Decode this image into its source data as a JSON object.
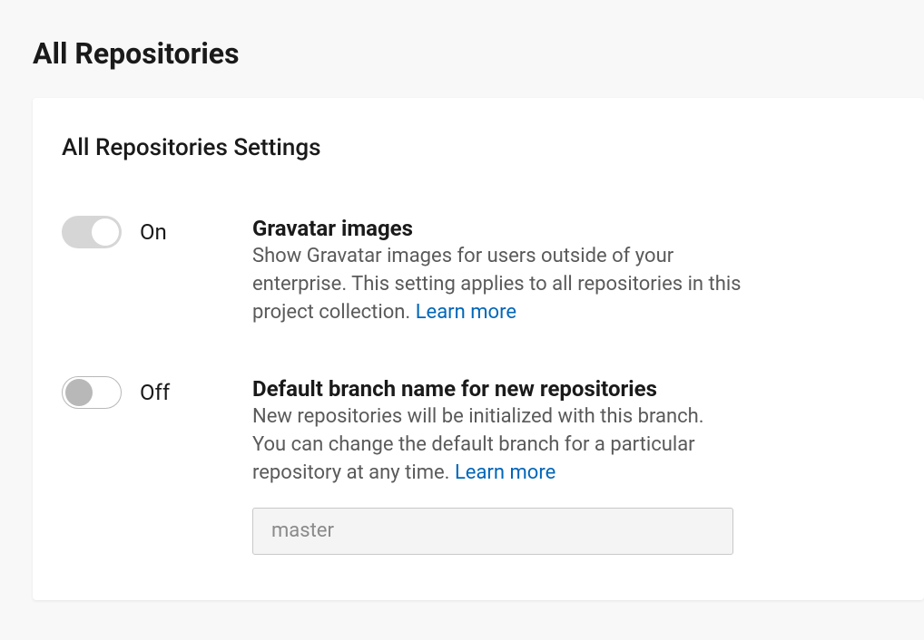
{
  "page": {
    "title": "All Repositories"
  },
  "card": {
    "title": "All Repositories Settings"
  },
  "settings": {
    "gravatar": {
      "toggle_state": "On",
      "title": "Gravatar images",
      "description": "Show Gravatar images for users outside of your enterprise. This setting applies to all repositories in this project collection. ",
      "learn_more": "Learn more"
    },
    "default_branch": {
      "toggle_state": "Off",
      "title": "Default branch name for new repositories",
      "description": "New repositories will be initialized with this branch. You can change the default branch for a particular repository at any time. ",
      "learn_more": "Learn more",
      "input_placeholder": "master",
      "input_value": ""
    }
  }
}
